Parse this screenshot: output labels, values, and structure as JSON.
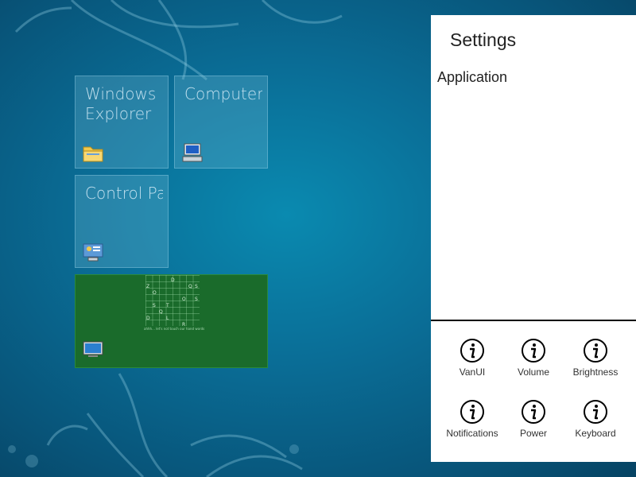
{
  "tiles": [
    {
      "title": "Windows Explorer",
      "icon": "folder-icon"
    },
    {
      "title": "Computer",
      "icon": "computer-icon"
    },
    {
      "title": "Control Panel",
      "icon": "control-panel-icon"
    }
  ],
  "game_tile": {
    "letters": [
      "D",
      "Q",
      "S",
      "Z",
      "O",
      "O",
      "S",
      "S",
      "T",
      "Q",
      "D",
      "L",
      "R"
    ],
    "caption": "ahhh... let's not touch our hand words",
    "icon": "monitor-icon"
  },
  "settings": {
    "title": "Settings",
    "section": "Application",
    "buttons": [
      {
        "label": "VanUI",
        "icon": "info-icon"
      },
      {
        "label": "Volume",
        "icon": "info-icon"
      },
      {
        "label": "Brightness",
        "icon": "info-icon"
      },
      {
        "label": "Notifications",
        "icon": "info-icon"
      },
      {
        "label": "Power",
        "icon": "info-icon"
      },
      {
        "label": "Keyboard",
        "icon": "info-icon"
      }
    ]
  },
  "colors": {
    "background": "#0a6d96",
    "tile": "#78bed7",
    "game_tile": "#1a6b2b",
    "panel": "#ffffff"
  }
}
